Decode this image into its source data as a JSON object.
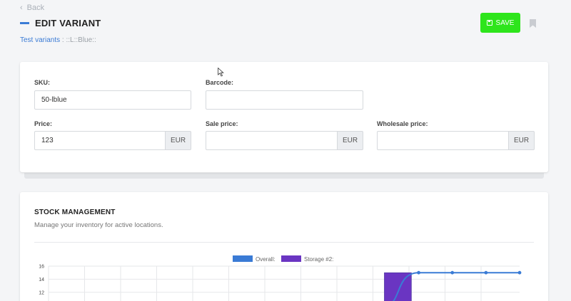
{
  "header": {
    "back_label": "Back",
    "title": "EDIT VARIANT",
    "save_label": "SAVE",
    "accent_color": "#3a7bd5",
    "save_color": "#2ee51c"
  },
  "breadcrumb": {
    "link": "Test variants",
    "rest": " : ::L::Blue::"
  },
  "form": {
    "sku": {
      "label": "SKU:",
      "value": "50-lblue"
    },
    "barcode": {
      "label": "Barcode:",
      "value": ""
    },
    "price": {
      "label": "Price:",
      "value": "123",
      "currency": "EUR"
    },
    "sale_price": {
      "label": "Sale price:",
      "value": "",
      "currency": "EUR"
    },
    "wholesale_price": {
      "label": "Wholesale price:",
      "value": "",
      "currency": "EUR"
    }
  },
  "stock": {
    "title": "STOCK MANAGEMENT",
    "subtitle": "Manage your inventory for active locations."
  },
  "chart_data": {
    "type": "line",
    "title": "",
    "xlabel": "",
    "ylabel": "",
    "ylim": [
      10,
      16
    ],
    "y_ticks": [
      "16",
      "14",
      "12"
    ],
    "grid": true,
    "legend": "top",
    "series": [
      {
        "name": "Overall:",
        "type": "line",
        "color": "#3a7bd5",
        "x": [
          10,
          11,
          12,
          13,
          14
        ],
        "values": [
          10,
          15,
          15,
          15,
          15
        ]
      },
      {
        "name": "Storage #2:",
        "type": "bar",
        "color": "#6a35c2",
        "x": [
          10
        ],
        "values": [
          15
        ]
      }
    ],
    "x_range": [
      0,
      14
    ]
  }
}
